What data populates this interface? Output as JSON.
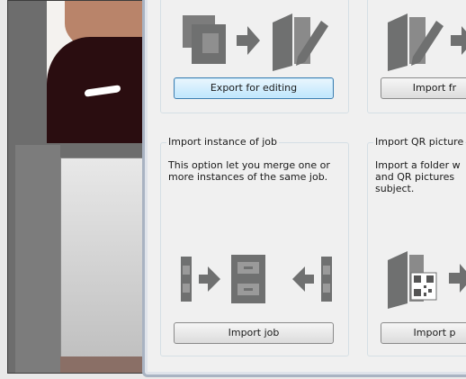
{
  "dialog": {
    "top_left": {
      "button_label": "Export for editing"
    },
    "top_right": {
      "button_label": "Import fr"
    },
    "bottom_left": {
      "title": "Import instance of job",
      "description": "This option let you merge one or more instances of the same job.",
      "button_label": "Import job"
    },
    "bottom_right": {
      "title": "Import QR picture",
      "description": "Import a folder w and QR pictures subject.",
      "button_label": "Import p"
    }
  },
  "icons": {
    "export": [
      "photo-stack-icon",
      "arrow-right-icon",
      "folder-edit-icon"
    ],
    "import_folder": [
      "folder-edit-icon",
      "arrow-right-icon"
    ],
    "import_job": [
      "cabinet-icon",
      "arrow-right-icon",
      "cabinet-icon",
      "arrow-left-icon",
      "cabinet-icon"
    ],
    "import_qr": [
      "qr-folder-icon",
      "arrow-right-icon"
    ]
  },
  "colors": {
    "icon_grey": "#6f7070",
    "button_focus": "#3c7fb1"
  }
}
